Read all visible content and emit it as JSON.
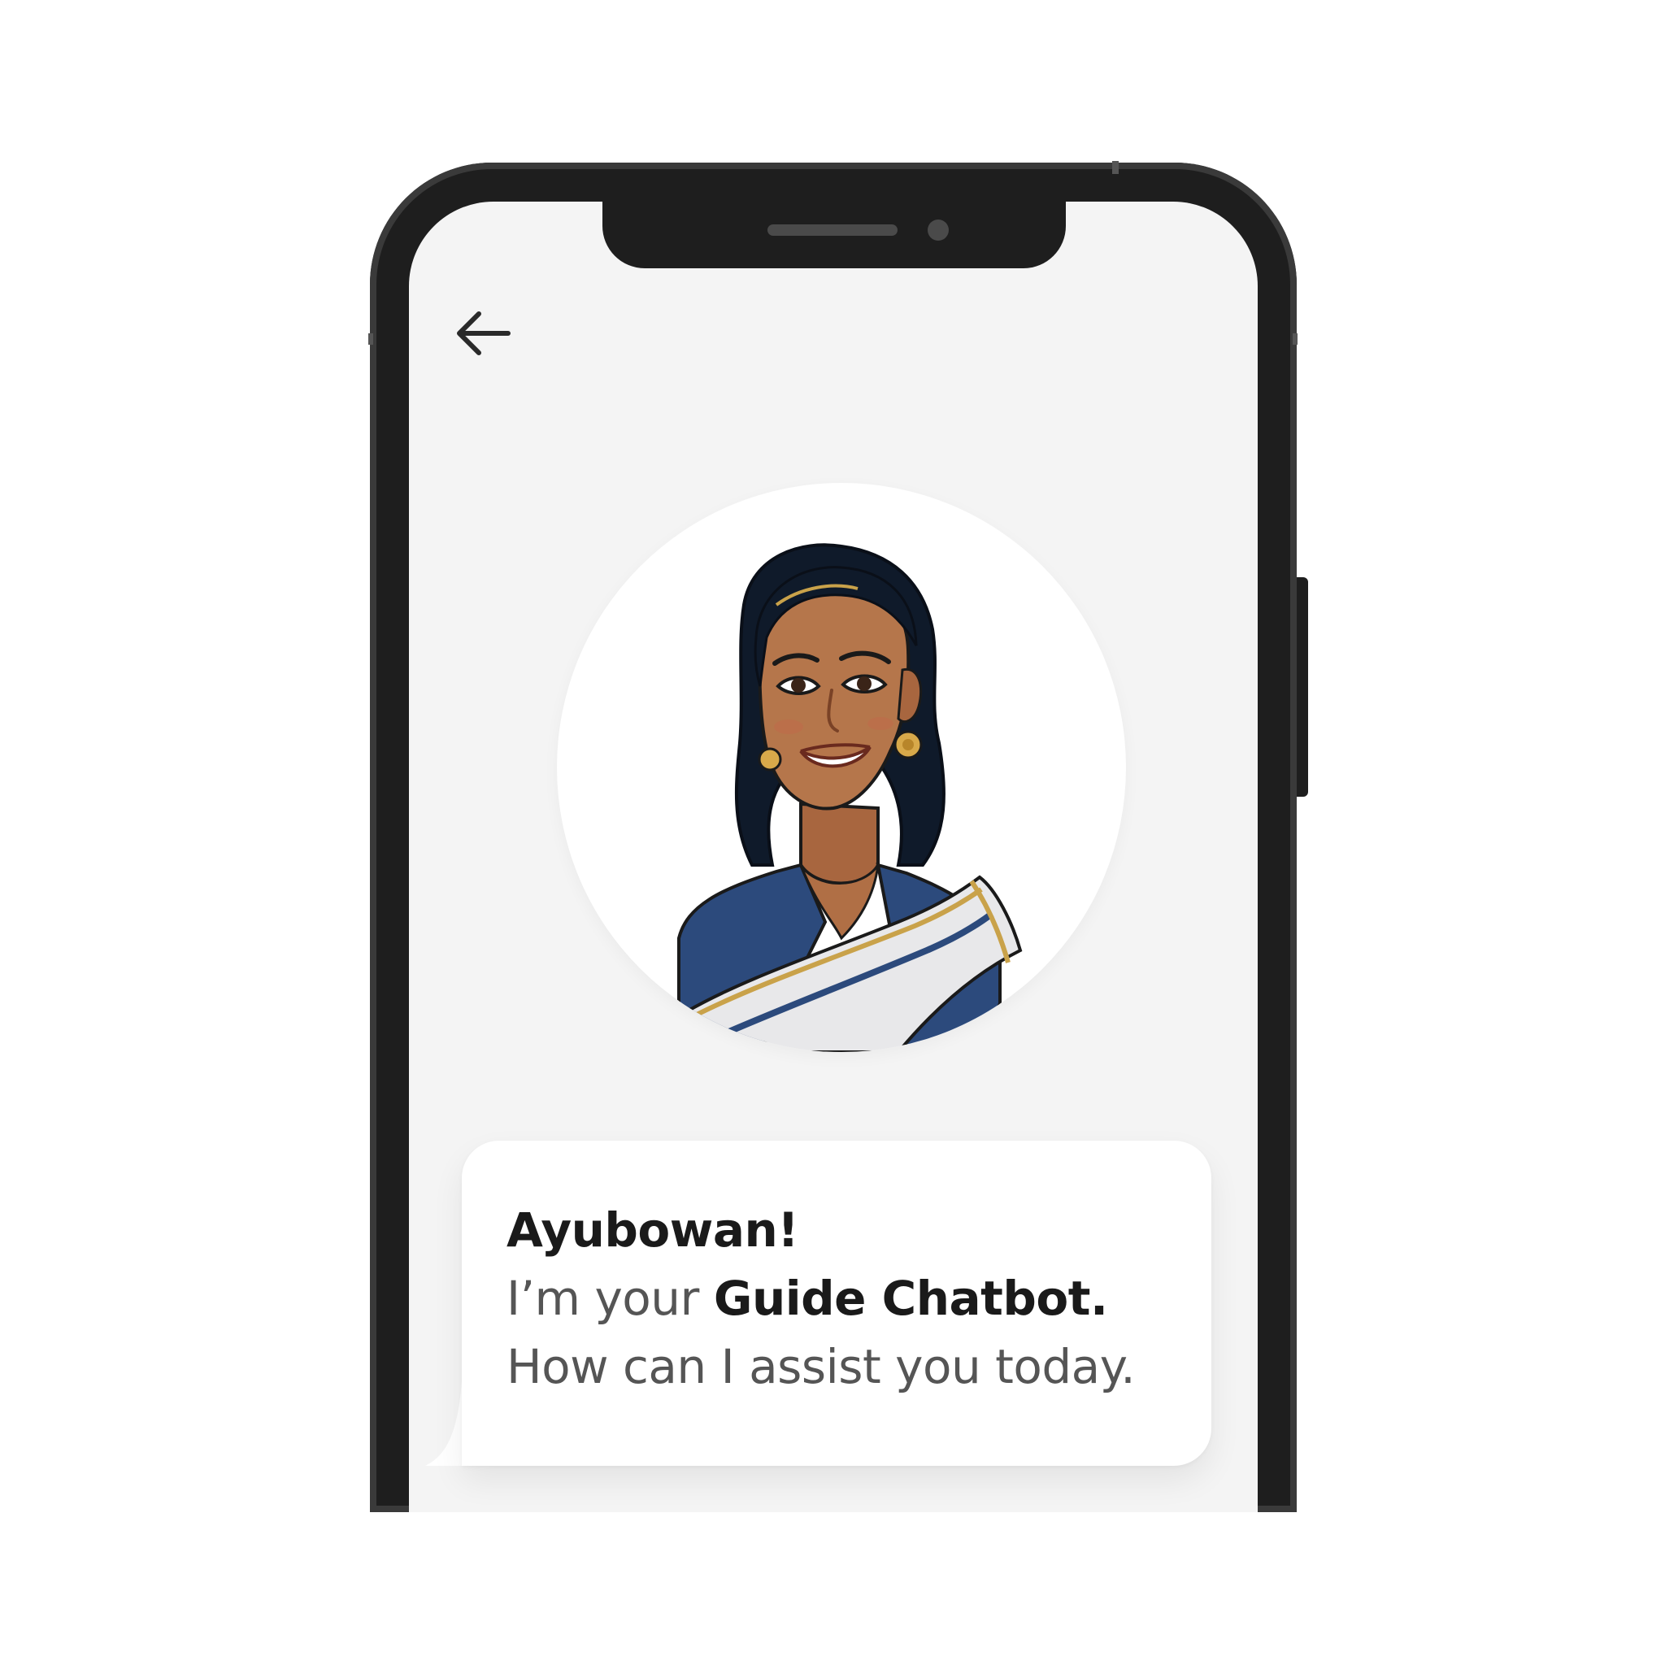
{
  "navigation": {
    "back_icon": "arrow-left-icon"
  },
  "assistant": {
    "avatar_icon": "assistant-avatar-illustration"
  },
  "message": {
    "greeting": "Ayubowan!",
    "intro_prefix": "I’m your ",
    "bot_name": "Guide Chatbot.",
    "question": "How can I assist you today."
  },
  "colors": {
    "screen_background": "#f4f4f4",
    "phone_frame": "#1e1e1e",
    "bubble_background": "#ffffff",
    "text_primary": "#1a1a1a",
    "text_secondary": "#555555"
  }
}
